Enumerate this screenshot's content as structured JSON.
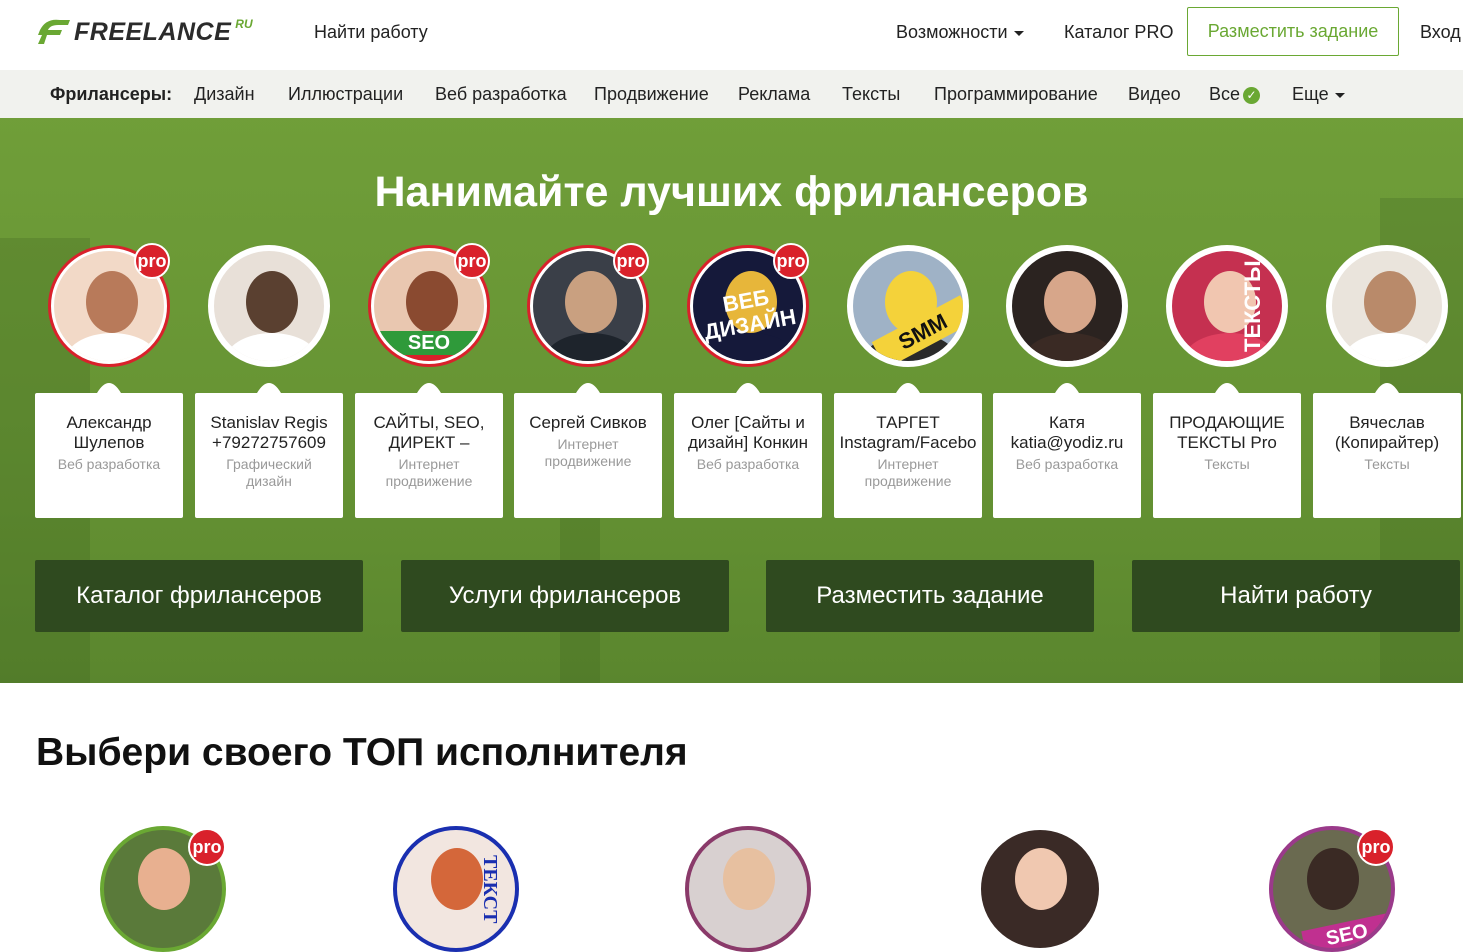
{
  "header": {
    "logo_text": "FREELANCE",
    "logo_suffix": "RU",
    "find_work": "Найти работу",
    "features": "Возможности",
    "catalog_pro": "Каталог PRO",
    "post_task": "Разместить задание",
    "login": "Вход"
  },
  "catbar": {
    "title": "Фрилансеры:",
    "items": [
      "Дизайн",
      "Иллюстрации",
      "Веб разработка",
      "Продвижение",
      "Реклама",
      "Тексты",
      "Программирование",
      "Видео",
      "Все",
      "Еще"
    ]
  },
  "hero": {
    "title": "Нанимайте лучших фрилансеров",
    "pro_label": "pro",
    "freelancers": [
      {
        "name1": "Александр",
        "name2": "Шулепов",
        "cat1": "Веб разработка",
        "cat2": "",
        "pro": true,
        "avatar_text": ""
      },
      {
        "name1": "Stanislav Regis",
        "name2": "+79272757609",
        "cat1": "Графический",
        "cat2": "дизайн",
        "pro": false,
        "avatar_text": ""
      },
      {
        "name1": "САЙТЫ, SEO,",
        "name2": "ДИРЕКТ –",
        "cat1": "Интернет",
        "cat2": "продвижение",
        "pro": true,
        "avatar_text": "SEO"
      },
      {
        "name1": "Сергей Сивков",
        "name2": "",
        "cat1": "Интернет",
        "cat2": "продвижение",
        "pro": true,
        "avatar_text": ""
      },
      {
        "name1": "Олег [Сайты и",
        "name2": "дизайн] Конкин",
        "cat1": "Веб разработка",
        "cat2": "",
        "pro": true,
        "avatar_text": "ВЕБ ДИЗАЙН"
      },
      {
        "name1": "ТАРГЕТ",
        "name2": "Instagram/Facebo",
        "cat1": "Интернет",
        "cat2": "продвижение",
        "pro": false,
        "avatar_text": "SMM"
      },
      {
        "name1": "Катя",
        "name2": "katia@yodiz.ru",
        "cat1": "Веб разработка",
        "cat2": "",
        "pro": false,
        "avatar_text": ""
      },
      {
        "name1": "ПРОДАЮЩИЕ",
        "name2": "ТЕКСТЫ Pro",
        "cat1": "Тексты",
        "cat2": "",
        "pro": false,
        "avatar_text": "ТЕКСТЫ"
      },
      {
        "name1": "Вячеслав",
        "name2": "(Копирайтер)",
        "cat1": "Тексты",
        "cat2": "",
        "pro": false,
        "avatar_text": ""
      }
    ],
    "buttons": [
      "Каталог фрилансеров",
      "Услуги фрилансеров",
      "Разместить задание",
      "Найти работу"
    ]
  },
  "top_section": {
    "title": "Выбери своего ТОП исполнителя",
    "pro_label": "pro",
    "avatar_texts": [
      "",
      "ТЕКСТ",
      "",
      "",
      "SEO"
    ]
  },
  "colors": {
    "brand_green": "#6aa833",
    "hero_green": "#6b9a37",
    "button_dark": "#2f4a1f",
    "pro_red": "#d9212b"
  }
}
